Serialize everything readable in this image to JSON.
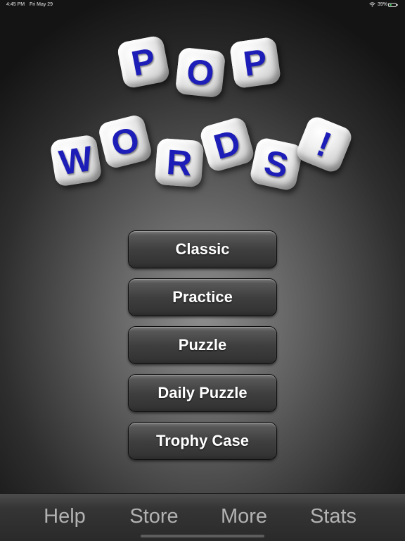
{
  "status_bar": {
    "time": "4:45 PM",
    "date": "Fri May 29",
    "battery_percent": "39%",
    "battery_level": 0.39,
    "wifi_icon": "wifi-icon",
    "battery_icon": "battery-icon"
  },
  "logo": {
    "row1": [
      "P",
      "O",
      "P"
    ],
    "row2": [
      "W",
      "O",
      "R",
      "D",
      "S",
      "!"
    ],
    "letter_color": "#1d1db8"
  },
  "menu": {
    "items": [
      {
        "label": "Classic"
      },
      {
        "label": "Practice"
      },
      {
        "label": "Puzzle"
      },
      {
        "label": "Daily Puzzle"
      },
      {
        "label": "Trophy Case"
      }
    ]
  },
  "toolbar": {
    "items": [
      {
        "label": "Help"
      },
      {
        "label": "Store"
      },
      {
        "label": "More"
      },
      {
        "label": "Stats"
      }
    ]
  }
}
